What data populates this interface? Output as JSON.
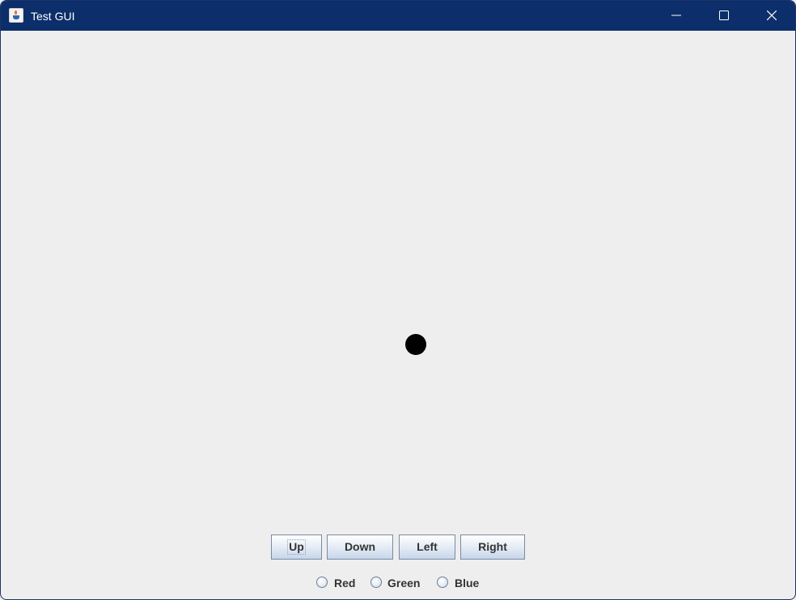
{
  "window": {
    "title": "Test GUI",
    "icon": "java-app-icon",
    "controls": [
      "minimize-icon",
      "maximize-icon",
      "close-icon"
    ]
  },
  "canvas": {
    "background": "#eeeeee",
    "ball_color": "#000000"
  },
  "buttons": {
    "up": "Up",
    "down": "Down",
    "left": "Left",
    "right": "Right"
  },
  "colors": {
    "red": "Red",
    "green": "Green",
    "blue": "Blue"
  },
  "theme": {
    "titlebar": "#0c2e6a",
    "title_text": "#ffffff"
  }
}
